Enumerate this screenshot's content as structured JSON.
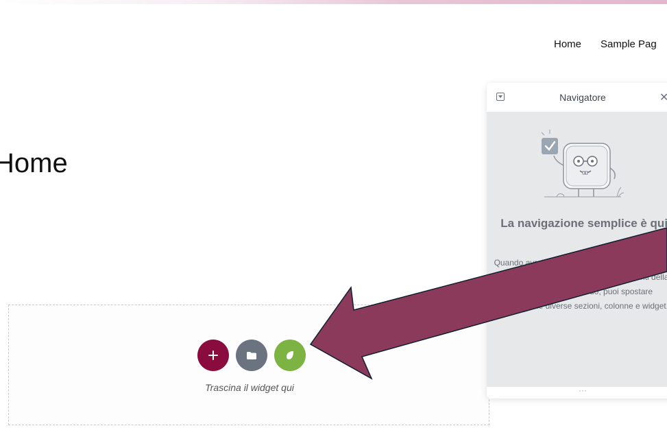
{
  "site_nav": {
    "items": [
      {
        "label": "Home"
      },
      {
        "label": "Sample Pag"
      }
    ]
  },
  "page": {
    "title": "Home"
  },
  "dropzone": {
    "hint": "Trascina il widget qui",
    "buttons": [
      {
        "name": "add-section",
        "icon": "plus-icon",
        "color": "#8a0c3f"
      },
      {
        "name": "add-template",
        "icon": "folder-icon",
        "color": "#6b7280"
      },
      {
        "name": "kit",
        "icon": "leaf-icon",
        "color": "#7cb342"
      }
    ]
  },
  "navigator": {
    "title": "Navigatore",
    "heading": "La navigazione semplice è qui!",
    "description": "Quando avrai aggiunto contenuti, questa finestra ti darà una panoramica di tutti gli elementi della pagina. In questo modo, puoi spostare facilmente le diverse sezioni, colonne e widget.",
    "footer": "···"
  },
  "annotation": {
    "arrow_color": "#8b3a5c"
  }
}
